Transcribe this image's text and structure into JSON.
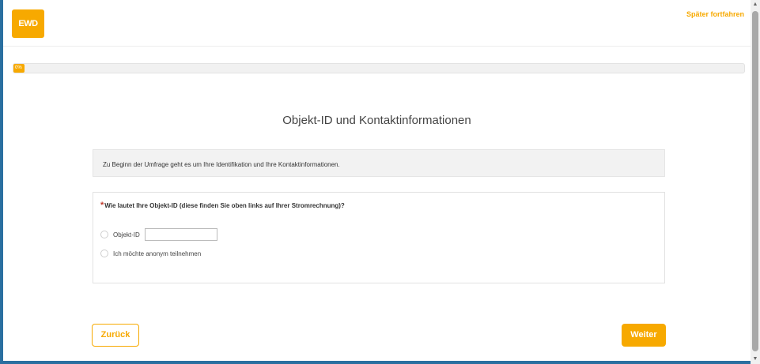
{
  "header": {
    "logo_text": "EWD",
    "later_link": "Später fortfahren"
  },
  "progress": {
    "value_percent": 0,
    "label": "0%"
  },
  "main": {
    "title": "Objekt-ID und Kontaktinformationen",
    "intro": "Zu Beginn der Umfrage geht es um Ihre Identifikation und Ihre Kontaktinformationen.",
    "question": {
      "required_mark": "*",
      "text": "Wie lautet Ihre Objekt-ID (diese finden Sie oben links auf Ihrer Stromrechnung)?",
      "options": [
        {
          "label": "Objekt-ID",
          "input_value": ""
        },
        {
          "label": "Ich möchte anonym teilnehmen"
        }
      ]
    }
  },
  "buttons": {
    "back": "Zurück",
    "next": "Weiter"
  },
  "colors": {
    "accent": "#f7a900",
    "required": "#c0392b"
  },
  "icons": {
    "scroll_up": "▲",
    "scroll_down": "▼"
  }
}
